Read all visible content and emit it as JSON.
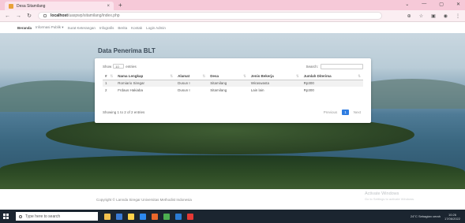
{
  "browser": {
    "tab_title": "Desa Sitamilang",
    "tab_close": "×",
    "new_tab": "+",
    "window_controls": [
      "⌄",
      "—",
      "▢",
      "✕"
    ],
    "url_host": "localhost",
    "url_path": "/uaspwp/sitamilang/index.php",
    "nav_back": "←",
    "nav_forward": "→",
    "nav_reload": "↻",
    "toolbar_icons": [
      "⊕",
      "☆",
      "▣",
      "◉",
      "⋮"
    ]
  },
  "sitenav": {
    "brand": "Beranda",
    "items": [
      "Informasi Publik ▾",
      "Surat Keterangan",
      "Infografis",
      "Berita",
      "Kontak",
      "Login Admin"
    ]
  },
  "panel": {
    "title": "Data Penerima BLT",
    "show_label": "Show",
    "show_value": "10",
    "entries_label": "entries",
    "search_label": "Search:",
    "columns": [
      "#",
      "Nama Lengkap",
      "Alamat",
      "Desa",
      "Jenis Bekerja",
      "Jumlah Diterima"
    ],
    "rows": [
      [
        "1",
        "Romiario Siregar",
        "Dusun I",
        "Sitamilang",
        "Wiraswasta",
        "Rp300"
      ],
      [
        "2",
        "Frdaus Hakiaba",
        "Dusun I",
        "Sitamilang",
        "Lain lain",
        "Rp300"
      ]
    ],
    "info": "Showing 1 to 2 of 2 entries",
    "pager_prev": "Previous",
    "pager_current": "1",
    "pager_next": "Next"
  },
  "footer": {
    "copyright": "Copyright © Lannda Siregar Universitas Methodist Indonesia",
    "activate_title": "Activate Windows",
    "activate_sub": "Go to Settings to activate Windows."
  },
  "taskbar": {
    "search_placeholder": "Type here to search",
    "weather": "24°C  Sebagian cerah",
    "time": "10:26",
    "date": "17/06/2022",
    "app_colors": [
      "#f2c14e",
      "#3a7bd5",
      "#ffd24a",
      "#2d89ef",
      "#e9672b",
      "#4caf50",
      "#2b7bd3",
      "#e53935"
    ]
  },
  "colors": {
    "accent": "#2f7de1",
    "tab_bg": "#f6c9d8",
    "taskbar_bg": "#1b2530"
  }
}
